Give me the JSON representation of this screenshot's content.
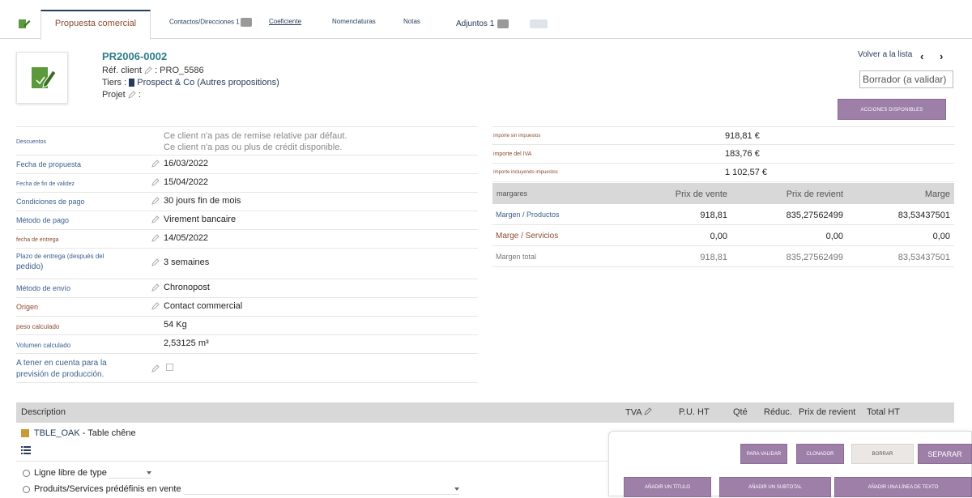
{
  "tabs": [
    {
      "label": "Propuesta comercial",
      "active": true
    },
    {
      "label": "Contactos/Direcciones",
      "badge": "1"
    },
    {
      "label": "Coeficiente"
    },
    {
      "label": "Nomenclaturas"
    },
    {
      "label": "Notas"
    },
    {
      "label": "Adjuntos",
      "count": "1"
    }
  ],
  "header": {
    "ref": "PR2006-0002",
    "ref_client_label": "Réf. client",
    "ref_client_value": ": PRO_5586",
    "tiers_label": "Tiers :",
    "tiers_value": "Prospect & Co (Autres propositions)",
    "projet_label": "Projet",
    "projet_value": ":",
    "back_label": "Volver a la lista",
    "prev": "‹",
    "next": "›",
    "status": "Borrador (a validar)",
    "actions_label": "ACCIONES DISPONIBLES"
  },
  "fields": [
    {
      "label": "Descuentos",
      "note1": "Ce client n'a pas de remise relative par défaut.",
      "note2": "Ce client n'a pas ou plus de crédit disponible."
    },
    {
      "label": "Fecha de propuesta",
      "value": "16/03/2022"
    },
    {
      "label": "Fecha de fin de validez",
      "value": "15/04/2022"
    },
    {
      "label": "Condiciones de pago",
      "value": "30 jours fin de mois"
    },
    {
      "label": "Método de pago",
      "value": "Virement bancaire"
    },
    {
      "label": "fecha de entrega",
      "value": "14/05/2022"
    },
    {
      "label": "Plazo de entrega (después del",
      "label2": "pedido)",
      "value": "3 semaines"
    },
    {
      "label": "Método de envío",
      "value": "Chronopost"
    },
    {
      "label": "Origen",
      "value": "Contact commercial"
    },
    {
      "label": "peso calculado",
      "value": "54 Kg"
    },
    {
      "label": "Volumen calculado",
      "value": "2,53125 m³"
    },
    {
      "label": "A tener en cuenta para la",
      "label2": "previsión de producción."
    }
  ],
  "totals": [
    {
      "label": "importe sin impuestos",
      "value": "918,81 €"
    },
    {
      "label": "importe del IVA",
      "value": "183,76 €"
    },
    {
      "label": "Importe incluyendo impuestos",
      "value": "1 102,57 €"
    }
  ],
  "margins": {
    "headers": [
      "margares",
      "Prix de vente",
      "Prix de revient",
      "Marge"
    ],
    "rows": [
      [
        "Margen / Productos",
        "918,81",
        "835,27562499",
        "83,53437501"
      ],
      [
        "Marge / Servicios",
        "0,00",
        "0,00",
        "0,00"
      ],
      [
        "Margen total",
        "918,81",
        "835,27562499",
        "83,53437501"
      ]
    ]
  },
  "lines": {
    "headers": {
      "description": "Description",
      "tva": "TVA",
      "pu": "P.U. HT",
      "qty": "Qté",
      "reduc": "Réduc.",
      "revient": "Prix de revient",
      "total": "Total HT"
    },
    "item_ref": "TBLE_OAK",
    "item_desc": "- Table chêne",
    "add_free": "Ligne libre de type",
    "add_predef": "Produits/Services prédéfinis en vente"
  },
  "actions": {
    "validate": "PARA VALIDAR",
    "clone": "CLONADOR",
    "delete": "BORRAR",
    "separate": "SEPARAR",
    "add_title": "AÑADIR UN TÍTULO",
    "add_subtotal": "AÑADIR UN SUBTOTAL",
    "add_text": "AÑADIR UNA LÍNEA DE TEXTO"
  },
  "colors": {
    "accent": "#9d7fa8",
    "link": "#263c5c",
    "label_brown": "#8b4a2f",
    "label_blue": "#3a5f8f",
    "ref_teal": "#2e7d8c",
    "icon_green": "#5b9a3c"
  }
}
